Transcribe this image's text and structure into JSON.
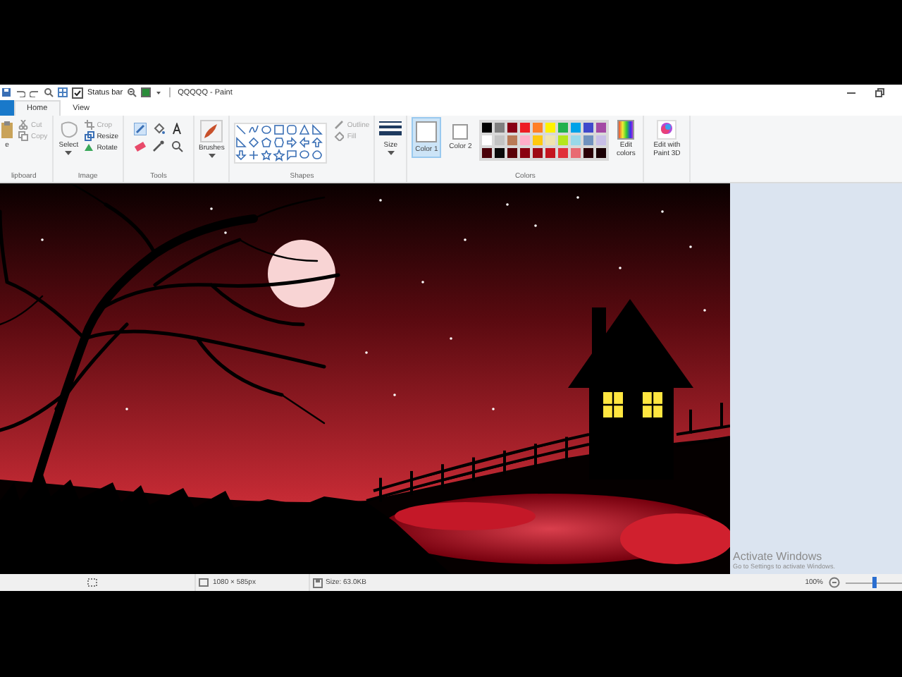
{
  "title_bar": {
    "status_bar_toggle": {
      "label": "Status bar",
      "checked": true
    },
    "title": "QQQQQ - Paint"
  },
  "tabs": [
    {
      "label": "Home",
      "selected": true
    },
    {
      "label": "View",
      "selected": false
    }
  ],
  "ribbon": {
    "clipboard": {
      "label": "lipboard",
      "paste": "e",
      "items": [
        {
          "label": "Cut",
          "disabled": true
        },
        {
          "label": "Copy",
          "disabled": true
        }
      ]
    },
    "image": {
      "label": "Image",
      "select": "Select",
      "items": [
        {
          "label": "Crop",
          "disabled": true
        },
        {
          "label": "Resize",
          "disabled": false
        },
        {
          "label": "Rotate",
          "disabled": false
        }
      ]
    },
    "tools": {
      "label": "Tools"
    },
    "brushes": {
      "label": "Brushes"
    },
    "shapes": {
      "label": "Shapes",
      "items": [
        {
          "label": "Outline",
          "disabled": true
        },
        {
          "label": "Fill",
          "disabled": true
        }
      ]
    },
    "size": {
      "label": "Size"
    },
    "colors": {
      "label": "Colors",
      "color_slots": [
        {
          "label": "Color 1",
          "selected": true,
          "color": "#ffffff"
        },
        {
          "label": "Color 2",
          "selected": false,
          "color": "#ffffff"
        }
      ],
      "palette": [
        {
          "color": "#000000"
        },
        {
          "color": "#7f7f7f"
        },
        {
          "color": "#880015"
        },
        {
          "color": "#ed1c24"
        },
        {
          "color": "#ff7f27"
        },
        {
          "color": "#fff200"
        },
        {
          "color": "#22b14c"
        },
        {
          "color": "#00a2e8"
        },
        {
          "color": "#3f48cc"
        },
        {
          "color": "#a349a4"
        },
        {
          "color": "#ffffff"
        },
        {
          "color": "#c3c3c3"
        },
        {
          "color": "#b97a57"
        },
        {
          "color": "#ffaec9"
        },
        {
          "color": "#ffc90e"
        },
        {
          "color": "#efe4b0"
        },
        {
          "color": "#b5e61d"
        },
        {
          "color": "#99d9ea"
        },
        {
          "color": "#7092be"
        },
        {
          "color": "#c8bfe7"
        },
        {
          "color": "#4a0008"
        },
        {
          "color": "#0a0a0a"
        },
        {
          "color": "#5a0008"
        },
        {
          "color": "#8a0010"
        },
        {
          "color": "#9e0a14"
        },
        {
          "color": "#c4141e"
        },
        {
          "color": "#e0303a"
        },
        {
          "color": "#e86a72"
        },
        {
          "color": "#2a0006"
        },
        {
          "color": "#1a0004"
        }
      ],
      "edit_colors": "Edit colors"
    },
    "paint_3d": "Edit with Paint 3D"
  },
  "activation_notice": {
    "title": "Activate Windows",
    "subtitle": "Go to Settings to activate Windows."
  },
  "status_bar": {
    "dimensions": "1080 × 585px",
    "file_size": "Size: 63.0KB",
    "zoom": "100%",
    "zoom_slider": {
      "level": 0.5
    }
  }
}
